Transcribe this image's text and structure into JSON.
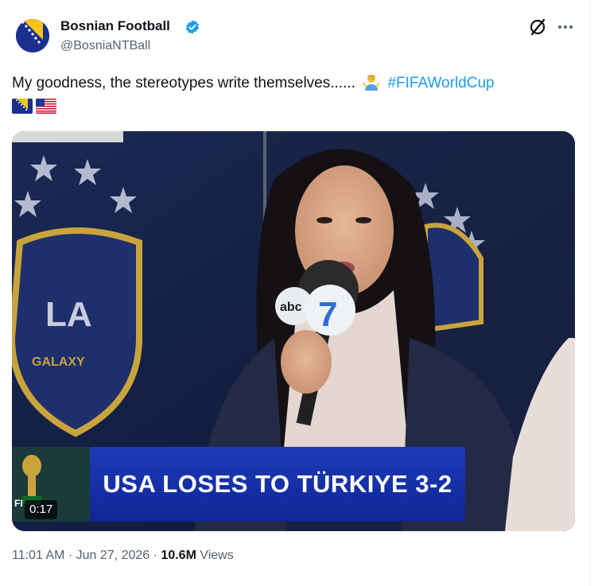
{
  "author": {
    "name": "Bosnian Football",
    "handle": "@BosniaNTBall",
    "verified": true
  },
  "header_actions": {
    "grok_icon": "grok-icon",
    "more_icon": "more-icon"
  },
  "tweet": {
    "text": "My goodness, the stereotypes write themselves......",
    "emoji": "person-shrugging",
    "hashtag": "#FIFAWorldCup",
    "flags": [
      "bosnia-flag",
      "usa-flag"
    ]
  },
  "media": {
    "chyron": "USA LOSES TO TÜRKIYE 3-2",
    "duration": "0:17",
    "badge_text": "FI",
    "background_text": "LA GALAXY",
    "mic_logo": "abc"
  },
  "footer": {
    "time": "11:01 AM",
    "date": "Jun 27, 2026",
    "views_count": "10.6M",
    "views_label": "Views"
  },
  "colors": {
    "link": "#1d9bf0",
    "secondary_text": "#536471",
    "chyron_blue": "#1d3bb8"
  }
}
